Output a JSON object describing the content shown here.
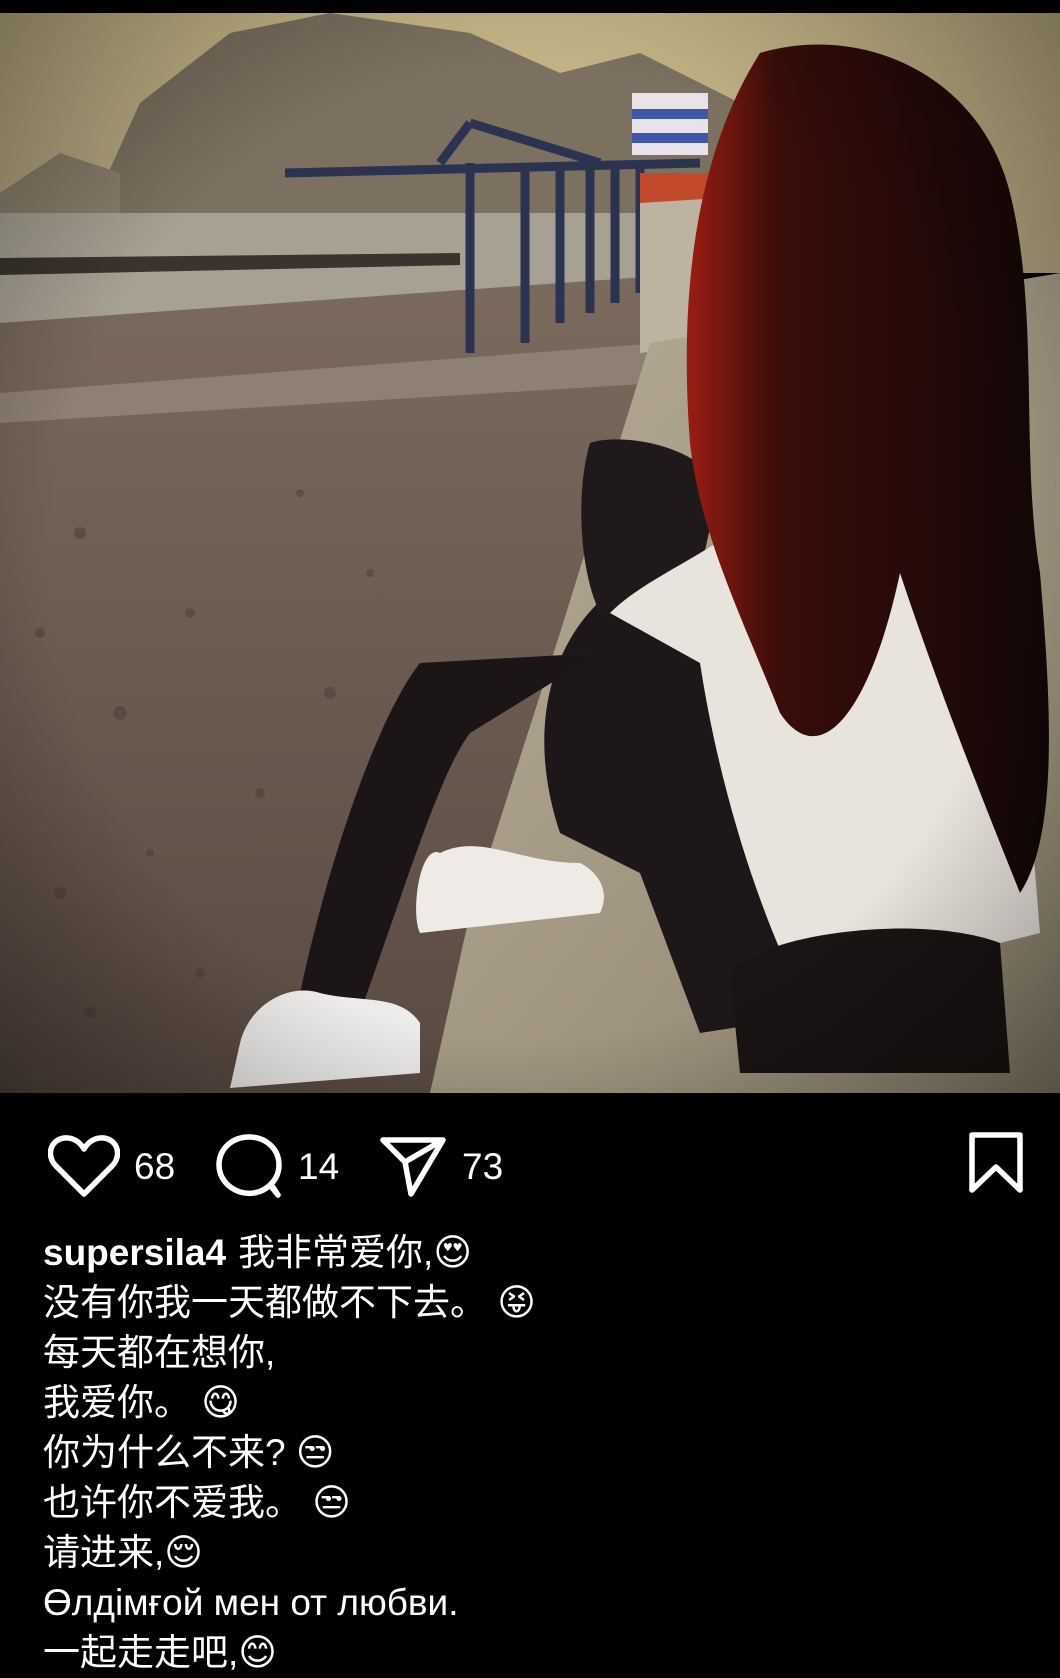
{
  "post": {
    "image_alt": "Girl with long red-black hair sitting on a beach wall",
    "likes": "68",
    "comments": "14",
    "shares": "73",
    "icons": {
      "like": "heart-icon",
      "comment": "comment-icon",
      "share": "send-icon",
      "save": "bookmark-icon"
    }
  },
  "caption": {
    "username": "supersila4",
    "lines": [
      "我非常爱你,😍",
      "没有你我一天都做不下去。 😝",
      "每天都在想你,",
      "我爱你。 😋",
      "你为什么不来? 😒",
      "也许你不爱我。 😒",
      "请进来,😌",
      " Өлдімғой мен от любви.",
      "一起走走吧,😊"
    ]
  }
}
